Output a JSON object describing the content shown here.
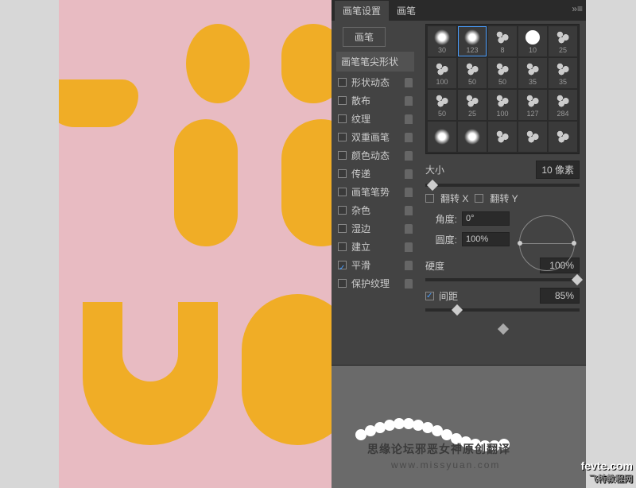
{
  "tabs": {
    "settings": "画笔设置",
    "brush": "画笔"
  },
  "brushButton": "画笔",
  "tipShape": "画笔笔尖形状",
  "options": [
    {
      "label": "形状动态",
      "checked": false,
      "lock": true
    },
    {
      "label": "散布",
      "checked": false,
      "lock": true
    },
    {
      "label": "纹理",
      "checked": false,
      "lock": true
    },
    {
      "label": "双重画笔",
      "checked": false,
      "lock": true
    },
    {
      "label": "颜色动态",
      "checked": false,
      "lock": true
    },
    {
      "label": "传递",
      "checked": false,
      "lock": true
    },
    {
      "label": "画笔笔势",
      "checked": false,
      "lock": true
    },
    {
      "label": "杂色",
      "checked": false,
      "lock": true
    },
    {
      "label": "湿边",
      "checked": false,
      "lock": true
    },
    {
      "label": "建立",
      "checked": false,
      "lock": true
    },
    {
      "label": "平滑",
      "checked": true,
      "lock": true
    },
    {
      "label": "保护纹理",
      "checked": false,
      "lock": true
    }
  ],
  "brushes": [
    {
      "size": "30"
    },
    {
      "size": "123"
    },
    {
      "size": "8"
    },
    {
      "size": "10"
    },
    {
      "size": "25"
    },
    {
      "size": "100"
    },
    {
      "size": "50"
    },
    {
      "size": "50"
    },
    {
      "size": "35"
    },
    {
      "size": "35"
    },
    {
      "size": "50"
    },
    {
      "size": "25"
    },
    {
      "size": "100"
    },
    {
      "size": "127"
    },
    {
      "size": "284"
    },
    {
      "size": ""
    },
    {
      "size": ""
    },
    {
      "size": ""
    },
    {
      "size": ""
    },
    {
      "size": ""
    }
  ],
  "selectedBrush": 1,
  "sizeLabel": "大小",
  "sizeValue": "10 像素",
  "flipX": "翻转 X",
  "flipY": "翻转 Y",
  "angleLabel": "角度:",
  "angleValue": "0°",
  "roundnessLabel": "圆度:",
  "roundnessValue": "100%",
  "hardnessLabel": "硬度",
  "hardnessValue": "100%",
  "spacingLabel": "间距",
  "spacingValue": "85%",
  "spacingChecked": true,
  "watermark1": "思缘论坛邪恶女神原创翻译",
  "watermark2": "www.missyuan.com",
  "logo": {
    "main": "fevte.com",
    "sub": "飞特教程网"
  }
}
